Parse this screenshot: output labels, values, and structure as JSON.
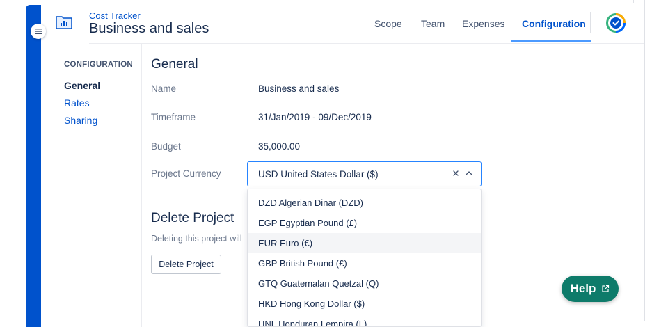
{
  "colors": {
    "brand_blue": "#0052cc",
    "help_green": "#0e7b6a",
    "tab_underline": "#4c9aff",
    "text_dark": "#172b4d",
    "text_muted": "#6b778c"
  },
  "app": {
    "subtitle": "Cost Tracker",
    "title": "Business and sales",
    "icon": "bar-chart-folder-icon"
  },
  "nav": {
    "tabs": [
      {
        "label": "Scope",
        "active": false
      },
      {
        "label": "Team",
        "active": false
      },
      {
        "label": "Expenses",
        "active": false
      },
      {
        "label": "Configuration",
        "active": true
      }
    ],
    "logo_icon": "check-circle-logo-icon"
  },
  "sidebar": {
    "heading": "CONFIGURATION",
    "items": [
      {
        "label": "General",
        "active": true
      },
      {
        "label": "Rates",
        "active": false
      },
      {
        "label": "Sharing",
        "active": false
      }
    ]
  },
  "general": {
    "title": "General",
    "fields": [
      {
        "label": "Name",
        "value": "Business and sales"
      },
      {
        "label": "Timeframe",
        "value": "31/Jan/2019 - 09/Dec/2019"
      },
      {
        "label": "Budget",
        "value": "35,000.00"
      },
      {
        "label": "Project Currency"
      }
    ],
    "currency": {
      "selected": "USD United States Dollar ($)",
      "options": [
        "DZD Algerian Dinar (DZD)",
        "EGP Egyptian Pound (£)",
        "EUR Euro (€)",
        "GBP British Pound (£)",
        "GTQ Guatemalan Quetzal (Q)",
        "HKD Hong Kong Dollar ($)",
        "HNL Honduran Lempira (L)"
      ],
      "highlighted_index": 2
    }
  },
  "delete": {
    "title": "Delete Project",
    "description": "Deleting this project will",
    "button_label": "Delete Project"
  },
  "help": {
    "label": "Help"
  }
}
